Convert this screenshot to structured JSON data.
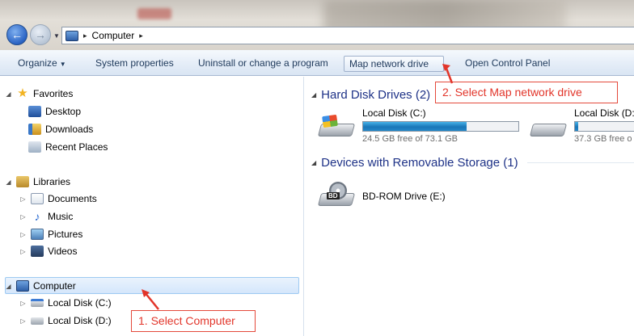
{
  "address": {
    "path_root_sep": "▸",
    "location": "Computer",
    "trailing_sep": "▸"
  },
  "toolbar": {
    "organize": "Organize",
    "system_properties": "System properties",
    "uninstall": "Uninstall or change a program",
    "map_network_drive": "Map network drive",
    "open_control_panel": "Open Control Panel"
  },
  "nav": {
    "favorites": "Favorites",
    "desktop": "Desktop",
    "downloads": "Downloads",
    "recent_places": "Recent Places",
    "libraries": "Libraries",
    "documents": "Documents",
    "music": "Music",
    "pictures": "Pictures",
    "videos": "Videos",
    "computer": "Computer",
    "local_disk_c": "Local Disk (C:)",
    "local_disk_d": "Local Disk (D:)"
  },
  "content": {
    "hard_disk_header": "Hard Disk Drives (2)",
    "removable_header": "Devices with Removable Storage (1)",
    "drives": [
      {
        "name": "Local Disk (C:)",
        "free": "24.5 GB free of 73.1 GB",
        "used_fraction": 0.665
      },
      {
        "name": "Local Disk (D:",
        "free": "37.3 GB free o",
        "used_fraction": 0.04
      }
    ],
    "bd_rom": "BD-ROM Drive (E:)",
    "bd_label": "BD"
  },
  "annotations": {
    "step1": "1. Select Computer",
    "step2": "2. Select Map network drive",
    "color": "#e2352a"
  }
}
